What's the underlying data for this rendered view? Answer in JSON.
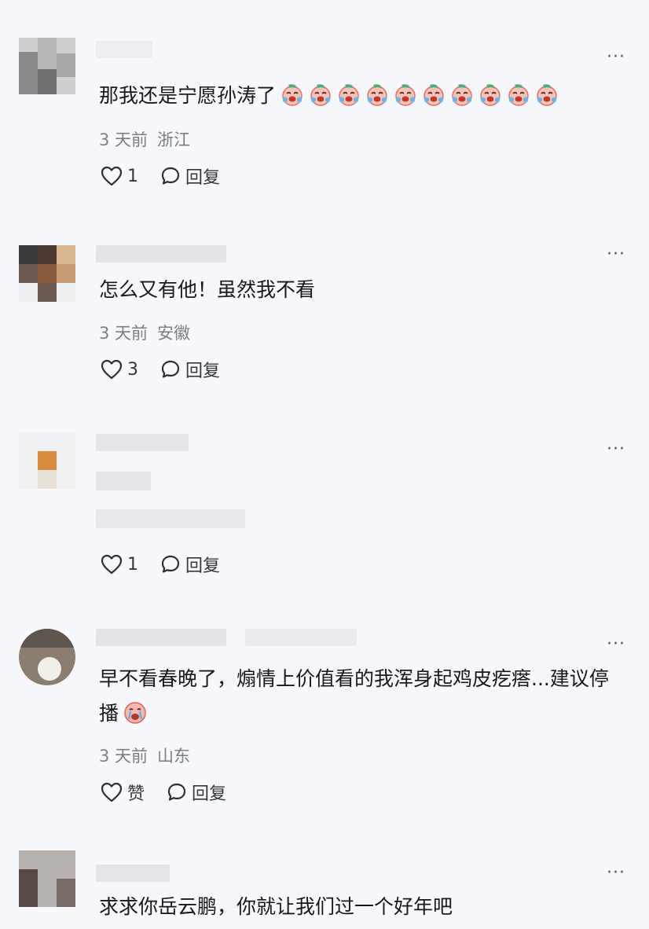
{
  "comments": [
    {
      "text": "那我还是宁愿孙涛了",
      "emoji_count": 10,
      "emoji": "crying-laughing-face-icon",
      "meta_time": "3 天前",
      "meta_location": "浙江",
      "likes": "1",
      "reply_label": "回复",
      "more": "···"
    },
    {
      "text": "怎么又有他！虽然我不看",
      "meta_time": "3 天前",
      "meta_location": "安徽",
      "likes": "3",
      "reply_label": "回复",
      "more": "···"
    },
    {
      "likes": "1",
      "reply_label": "回复",
      "more": "···"
    },
    {
      "text": "早不看春晚了，煽情上价值看的我浑身起鸡皮疙瘩...建议停播",
      "emoji": "crying-face-icon",
      "meta_time": "3 天前",
      "meta_location": "山东",
      "likes": "赞",
      "reply_label": "回复",
      "more": "···"
    },
    {
      "text": "求求你岳云鹏，你就让我们过一个好年吧",
      "more": "···"
    }
  ],
  "colors": {
    "background": "#f7f8fb",
    "text": "#18181c",
    "meta": "#7b7e86",
    "blur": "#e4e5e9"
  }
}
